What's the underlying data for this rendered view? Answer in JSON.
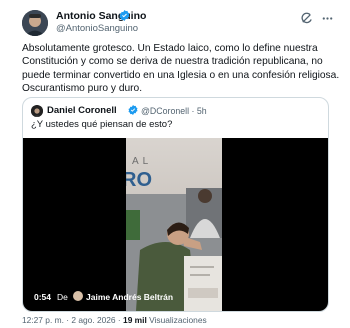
{
  "author": {
    "name": "Antonio Sanguino",
    "handle": "@AntonioSanguino"
  },
  "icons": [
    "verified-badge-icon",
    "grok-icon",
    "more-icon"
  ],
  "colors": {
    "verified": "#1d9bf0",
    "text": "#0f1419",
    "muted": "#536471",
    "border": "#cfd9de"
  },
  "post_text": {
    "line1": "Absolutamente grotesco. Un Estado laico, como lo define nuestra",
    "line2": "Constitución y como se deriva de nuestra tradición republicana, no",
    "line3": "puede terminar convertido en una Iglesia o en una confesión religiosa.",
    "line4": "Oscurantismo puro y duro."
  },
  "quoted_post": {
    "name": "Daniel Coronell",
    "handle": "@DCoronell · 5h",
    "text": "¿Y ustedes qué piensan de esto?",
    "video": {
      "time": "0:54",
      "credit_prefix": "De",
      "credit_name": "Jaime Andrés Beltrán",
      "backdrop_text": "AL RO"
    }
  },
  "meta": {
    "time": "12:27 p. m. · 2 ago. 2026 · ",
    "views_count": "19 mil",
    "views_label": " Visualizaciones"
  }
}
